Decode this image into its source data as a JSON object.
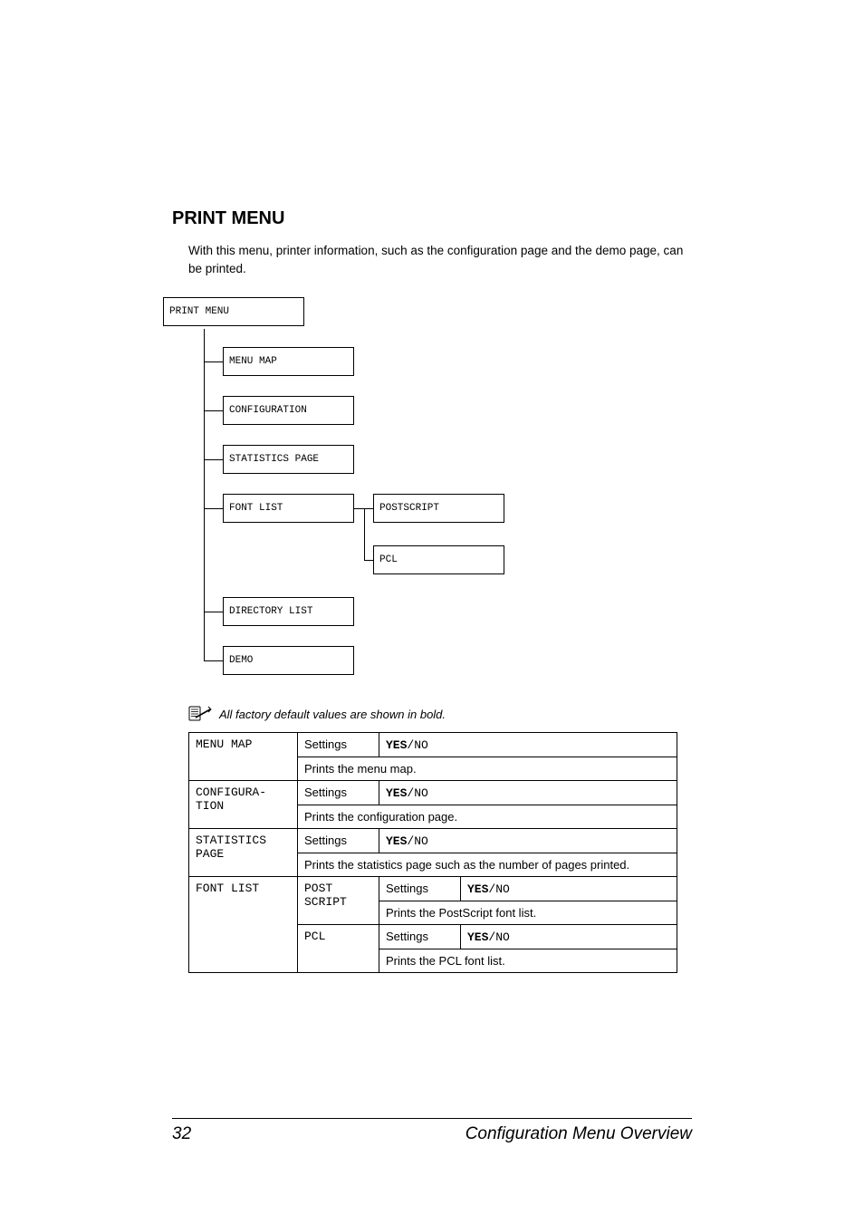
{
  "heading": "PRINT MENU",
  "intro": "With this menu, printer information, such as the configuration page and the demo page, can be printed.",
  "tree": {
    "root": "PRINT MENU",
    "children": {
      "menu_map": "MENU MAP",
      "configuration": "CONFIGURATION",
      "statistics_page": "STATISTICS PAGE",
      "font_list": "FONT LIST",
      "directory_list": "DIRECTORY LIST",
      "demo": "DEMO"
    },
    "font_list_children": {
      "postscript": "POSTSCRIPT",
      "pcl": "PCL"
    }
  },
  "note": "All factory default values are shown in bold.",
  "table": {
    "settings_label": "Settings",
    "yes": "YES",
    "no": "NO",
    "slash": "/",
    "rows": {
      "menu_map": {
        "label": "MENU MAP",
        "desc": "Prints the menu map."
      },
      "configuration": {
        "label": "CONFIGURA-TION",
        "label1": "CONFIGURA-",
        "label2": "TION",
        "desc": "Prints the configuration page."
      },
      "statistics": {
        "label": "STATISTICS PAGE",
        "label1": "STATISTICS",
        "label2": "PAGE",
        "desc": "Prints the statistics page such as the number of pages printed."
      },
      "font_list": {
        "label": "FONT LIST",
        "postscript": {
          "label": "POST SCRIPT",
          "label1": "POST",
          "label2": "SCRIPT",
          "desc": "Prints the PostScript font list."
        },
        "pcl": {
          "label": "PCL",
          "desc": "Prints the PCL font list."
        }
      }
    }
  },
  "footer": {
    "page": "32",
    "title": "Configuration Menu Overview"
  }
}
